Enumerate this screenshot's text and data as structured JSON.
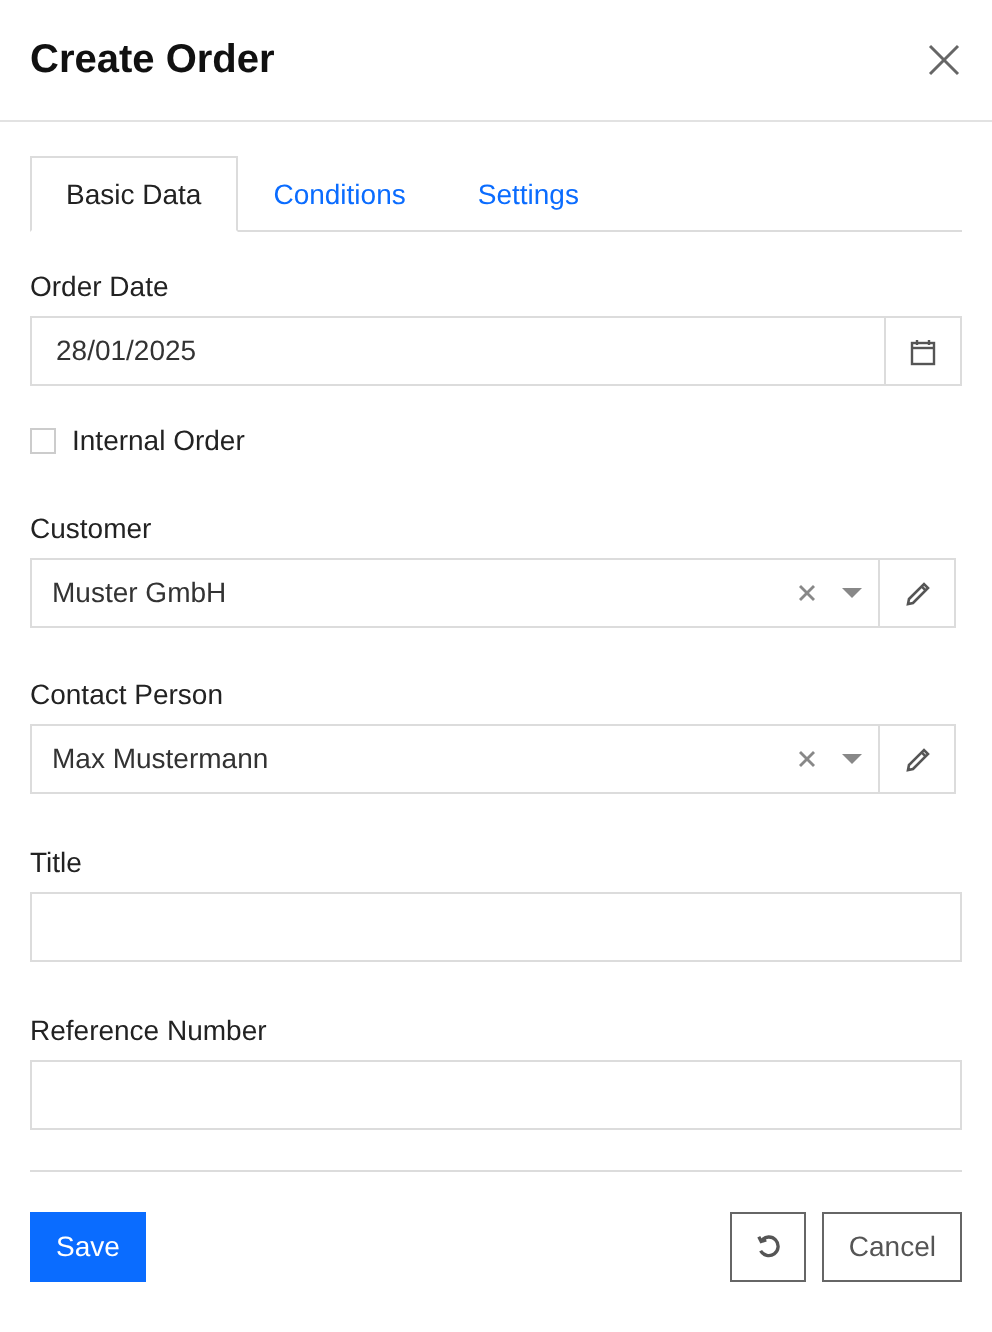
{
  "dialog": {
    "title": "Create Order"
  },
  "tabs": [
    {
      "label": "Basic Data",
      "selected": true
    },
    {
      "label": "Conditions",
      "selected": false
    },
    {
      "label": "Settings",
      "selected": false
    }
  ],
  "fields": [
    {
      "kind": "date",
      "label": "Order Date",
      "value": "28/01/2025"
    },
    {
      "kind": "checkbox",
      "label": "Internal Order",
      "checked": false
    },
    {
      "kind": "select",
      "label": "Customer",
      "value": "Muster GmbH"
    },
    {
      "kind": "select",
      "label": "Contact Person",
      "value": "Max Mustermann"
    },
    {
      "kind": "text",
      "label": "Title"
    },
    {
      "kind": "text",
      "label": "Reference Number"
    }
  ],
  "footer": {
    "save": "Save",
    "cancel": "Cancel"
  }
}
